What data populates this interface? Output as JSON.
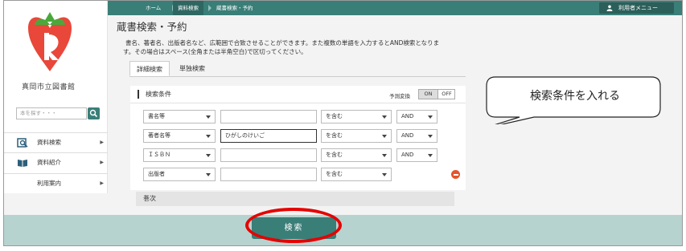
{
  "breadcrumb": {
    "home": "ホーム",
    "section": "資料検索",
    "current": "蔵書検索・予約"
  },
  "user_menu_label": "利用者メニュー",
  "sidebar": {
    "library_name": "真岡市立図書館",
    "search_placeholder": "本を探す・・・",
    "items": [
      {
        "label": "資料検索",
        "icon": "magnifier-book-icon"
      },
      {
        "label": "資料紹介",
        "icon": "open-book-icon"
      },
      {
        "label": "利用案内",
        "icon": ""
      }
    ]
  },
  "page": {
    "title": "蔵書検索・予約",
    "description_line1": "書名、著者名、出版者名など、広範囲で合致させることができます。また複数の単語を入力するとAND検索となりま",
    "description_line2": "す。その場合はスペース(全角または半角空白)で区切ってください。",
    "tabs": [
      "詳細検索",
      "単独検索"
    ],
    "active_tab": "詳細検索"
  },
  "conditions": {
    "title": "検索条件",
    "prediction_label": "予測変換",
    "toggle_on": "ON",
    "toggle_off": "OFF",
    "rows": [
      {
        "field": "書名等",
        "value": "",
        "match": "を含む",
        "logic": "AND"
      },
      {
        "field": "著者名等",
        "value": "ひがしのけいご",
        "match": "を含む",
        "logic": "AND"
      },
      {
        "field": "ＩＳＢＮ",
        "value": "",
        "match": "を含む",
        "logic": "AND"
      },
      {
        "field": "出版者",
        "value": "",
        "match": "を含む",
        "logic": ""
      }
    ]
  },
  "volume_label": "巻次",
  "search_button": "検索",
  "callout_text": "検索条件を入れる",
  "colors": {
    "accent": "#3a7e78",
    "bottom_bar": "#b7d3cf",
    "highlight_ring": "#e60000",
    "remove_button": "#e2562c"
  }
}
